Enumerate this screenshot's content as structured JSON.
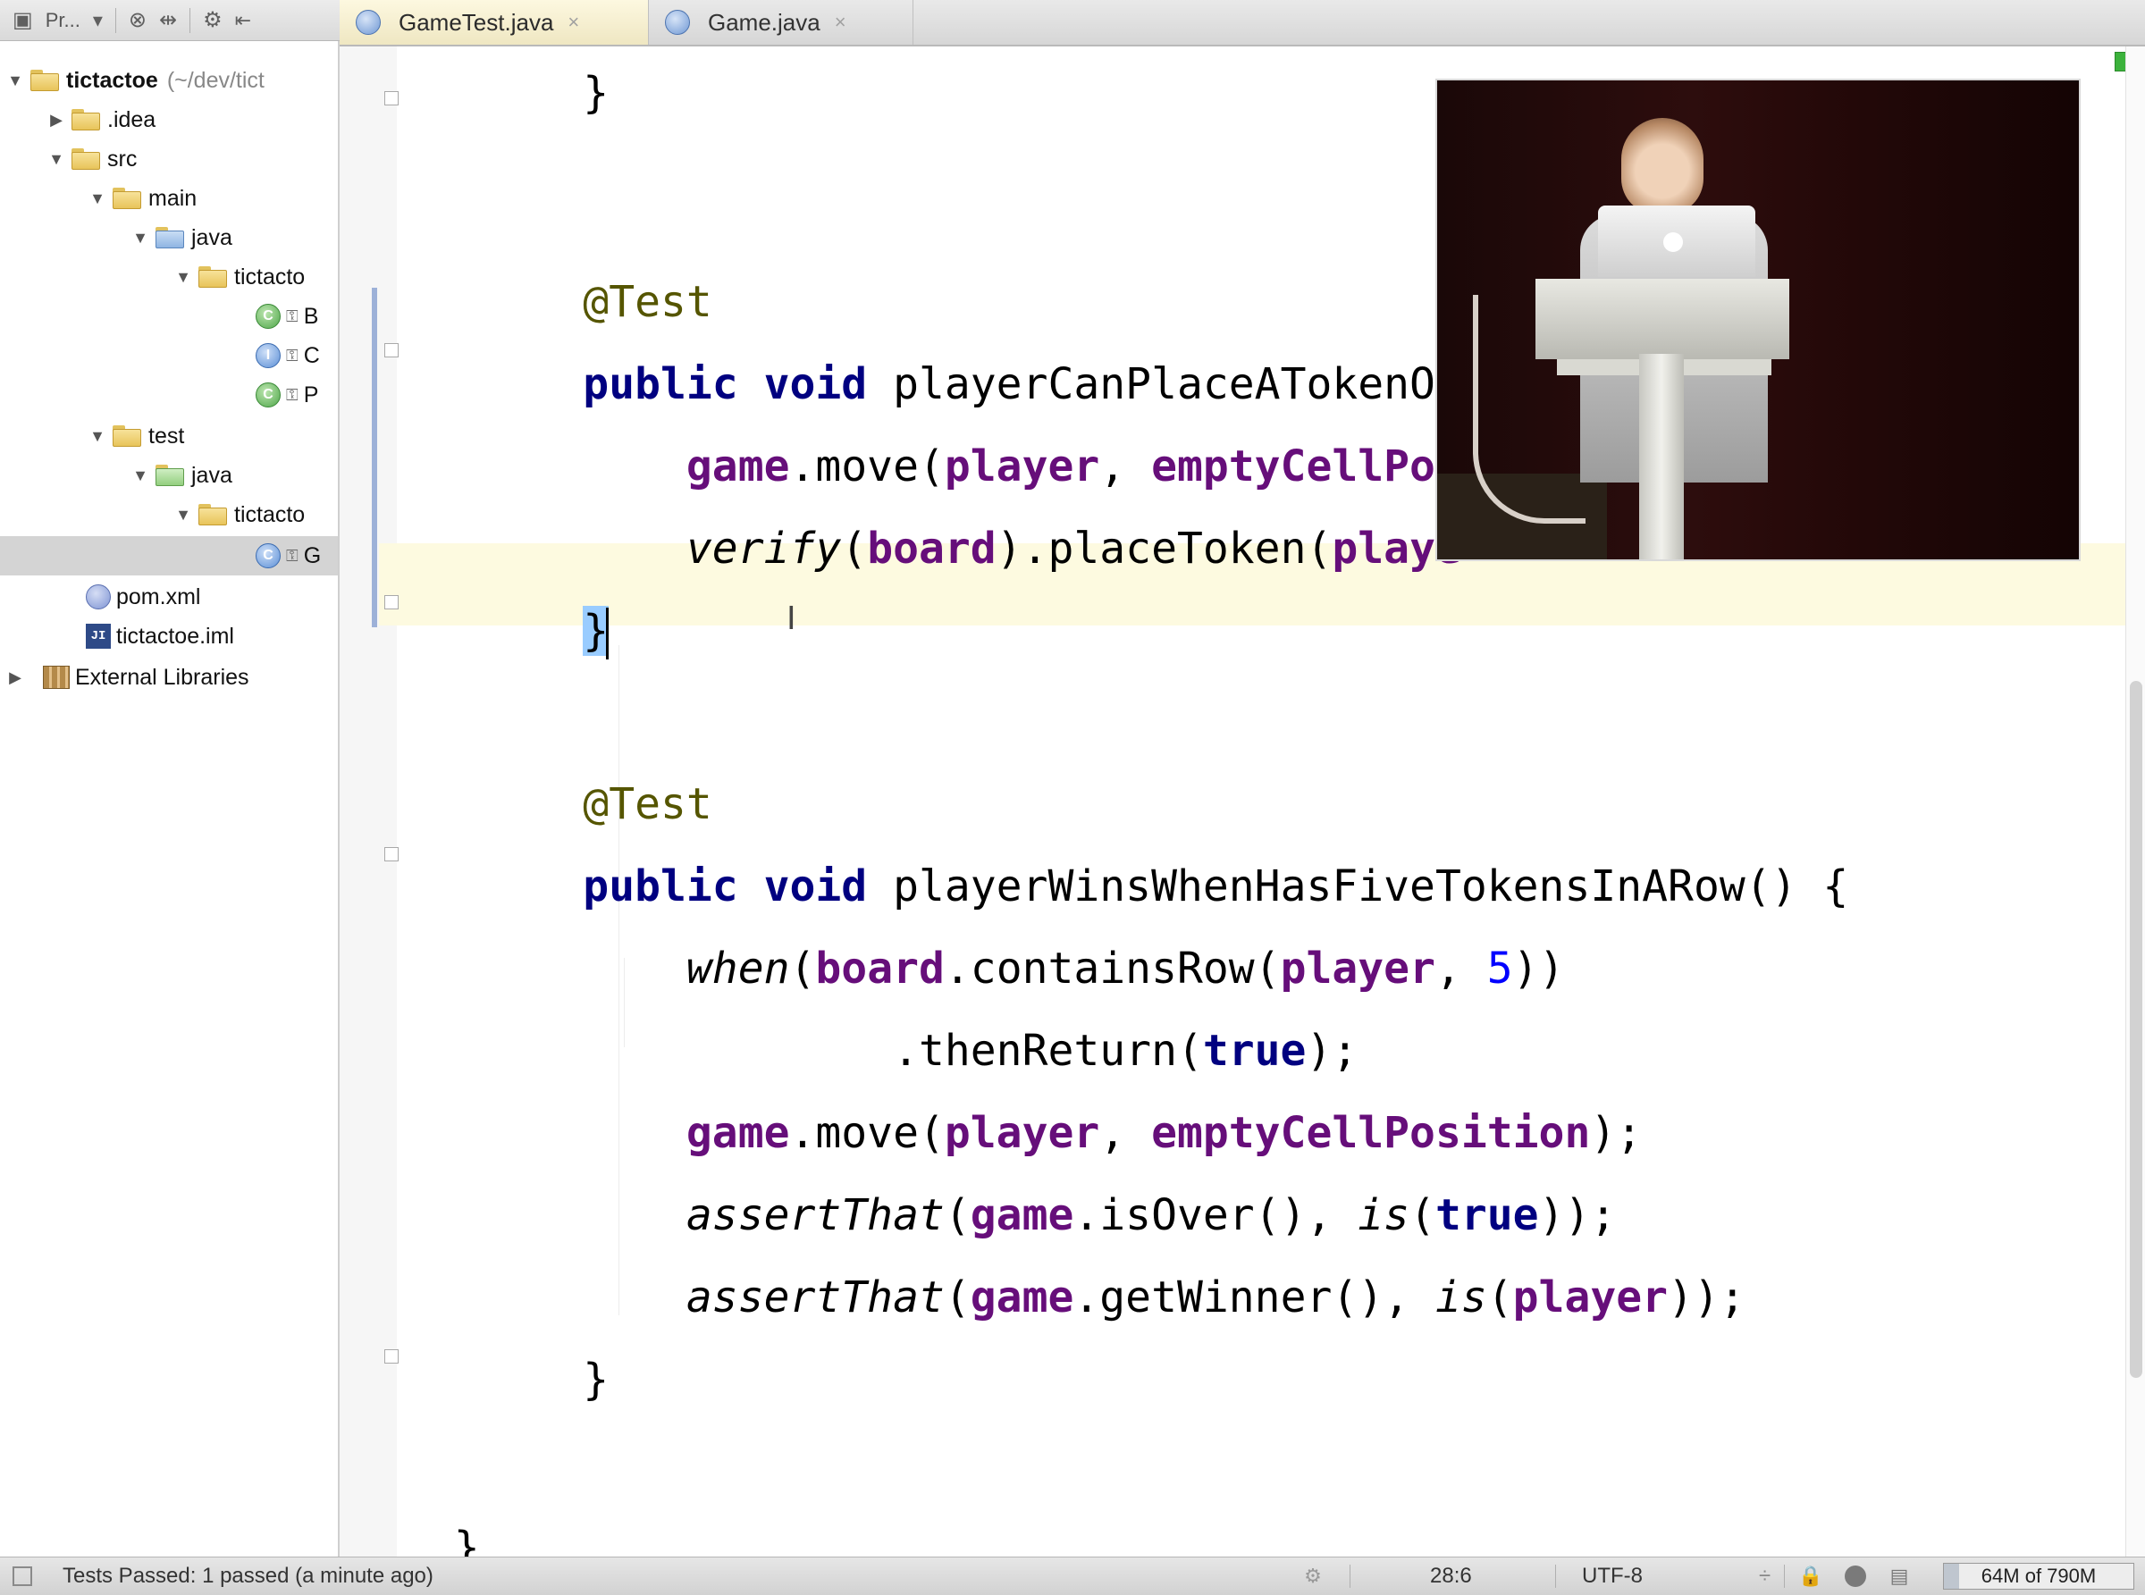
{
  "toolbar": {
    "project_label": "Pr...",
    "icons": [
      "project-view-icon",
      "dropdown-icon",
      "scroll-from-source-icon",
      "collapse-all-icon",
      "settings-icon",
      "hide-icon"
    ]
  },
  "project_tree": {
    "root": {
      "name": "tictactoe",
      "path": "(~/dev/tict"
    },
    "idea": ".idea",
    "src": "src",
    "main": "main",
    "main_java": "java",
    "main_pkg": "tictacto",
    "main_classes": [
      "B",
      "C",
      "P"
    ],
    "test": "test",
    "test_java": "java",
    "test_pkg": "tictacto",
    "test_class": "G",
    "pom": "pom.xml",
    "iml": "tictactoe.iml",
    "external": "External Libraries"
  },
  "tabs": [
    {
      "label": "GameTest.java",
      "close": "×",
      "active": true
    },
    {
      "label": "Game.java",
      "close": "×",
      "active": false
    }
  ],
  "code": {
    "l1_brace": "}",
    "l2_annotation": "@Test",
    "l3_public": "public",
    "l3_void": "void",
    "l3_method": " playerCanPlaceATokenOn",
    "l4_game": "game",
    "l4_move": ".move(",
    "l4_player": "player",
    "l4_comma": ", ",
    "l4_empty": "emptyCellPos",
    "l5_verify": "verify",
    "l5_paren": "(",
    "l5_board": "board",
    "l5_place": ").placeToken(",
    "l5_player": "playe",
    "l6_brace": "}",
    "l7_annotation": "@Test",
    "l8_public": "public",
    "l8_void": "void",
    "l8_method": " playerWinsWhenHasFiveTokensInARow() {",
    "l9_when": "when",
    "l9_paren": "(",
    "l9_board": "board",
    "l9_contains": ".containsRow(",
    "l9_player": "player",
    "l9_comma": ", ",
    "l9_five": "5",
    "l9_close": "))",
    "l10_then": ".thenReturn(",
    "l10_true": "true",
    "l10_close": ");",
    "l11_game": "game",
    "l11_move": ".move(",
    "l11_player": "player",
    "l11_comma": ", ",
    "l11_empty": "emptyCellPosition",
    "l11_close": ");",
    "l12_assert": "assertThat",
    "l12_paren": "(",
    "l12_game": "game",
    "l12_isover": ".isOver(), ",
    "l12_is": "is",
    "l12_paren2": "(",
    "l12_true": "true",
    "l12_close": "));",
    "l13_assert": "assertThat",
    "l13_paren": "(",
    "l13_game": "game",
    "l13_getwinner": ".getWinner(), ",
    "l13_is": "is",
    "l13_paren2": "(",
    "l13_player": "player",
    "l13_close": "));",
    "l14_brace": "}",
    "l15_brace": "}"
  },
  "status_bar": {
    "message": "Tests Passed: 1 passed (a minute ago)",
    "position": "28:6",
    "encoding": "UTF-8",
    "encoding_arrow": "÷",
    "memory": "64M of 790M",
    "memory_fraction": 0.08
  },
  "colors": {
    "keyword": "#000080",
    "field": "#660e7a",
    "annotation": "#555500",
    "current_line": "#fdfae0",
    "ok_indicator": "#3cb23c"
  }
}
